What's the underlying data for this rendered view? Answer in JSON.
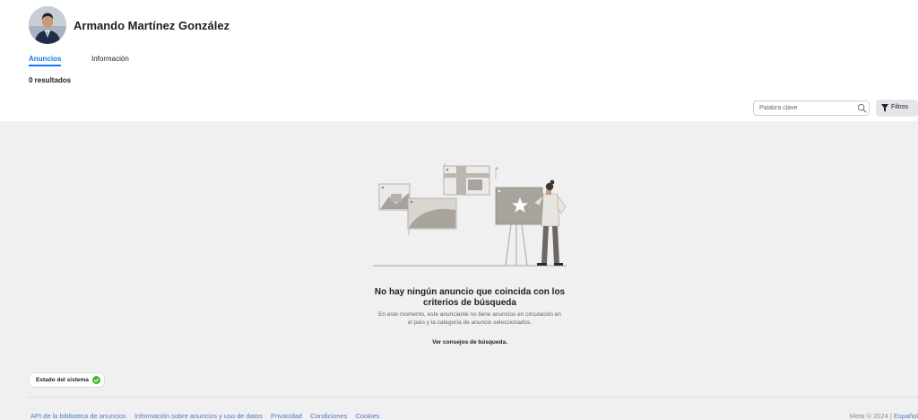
{
  "profile": {
    "name": "Armando Martínez González"
  },
  "tabs": [
    {
      "label": "Anuncios"
    },
    {
      "label": "Información"
    }
  ],
  "results": {
    "count_label": "0 resultados"
  },
  "search": {
    "placeholder": "Palabra clave",
    "icon": "search-icon"
  },
  "filters": {
    "label": "Filtros",
    "icon": "filter-icon"
  },
  "empty_state": {
    "title": "No hay ningún anuncio que coincida con los criterios de búsqueda",
    "description": "En este momento, este anunciante no tiene anuncios en circulación en el país y la categoría de anuncio seleccionados.",
    "link": "Ver consejos de búsqueda."
  },
  "system_status": {
    "label": "Estado del sistema",
    "icon": "check-circle-icon",
    "color": "#42b72a"
  },
  "footer": {
    "links": [
      "API de la biblioteca de anuncios",
      "Información sobre anuncios y uso de datos",
      "Privacidad",
      "Condiciones",
      "Cookies"
    ],
    "copyright": "Meta © 2024 |",
    "language": "Español"
  },
  "colors": {
    "accent": "#1877f2",
    "link": "#4a7ac7",
    "background": "#f0f0f0"
  }
}
